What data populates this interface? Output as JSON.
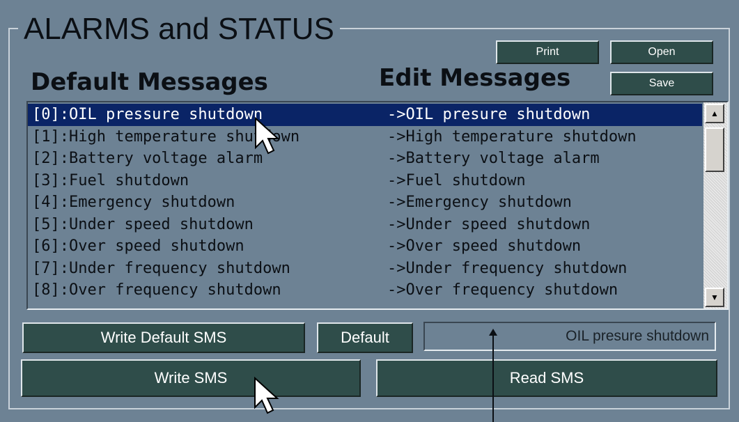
{
  "panel": {
    "title": "ALARMS and STATUS"
  },
  "headings": {
    "default_messages": "Default Messages",
    "edit_messages": "Edit Messages"
  },
  "toolbar": {
    "print_label": "Print",
    "open_label": "Open",
    "save_label": "Save"
  },
  "messages": [
    {
      "default": "[0]:OIL pressure shutdown",
      "edit": "->OIL presure shutdown",
      "selected": true
    },
    {
      "default": "[1]:High temperature shutdown",
      "edit": "->High temperature shutdown",
      "selected": false
    },
    {
      "default": "[2]:Battery voltage alarm",
      "edit": "->Battery voltage alarm",
      "selected": false
    },
    {
      "default": "[3]:Fuel shutdown",
      "edit": "->Fuel shutdown",
      "selected": false
    },
    {
      "default": "[4]:Emergency  shutdown",
      "edit": "->Emergency shutdown",
      "selected": false
    },
    {
      "default": "[5]:Under speed shutdown",
      "edit": "->Under speed shutdown",
      "selected": false
    },
    {
      "default": "[6]:Over speed shutdown",
      "edit": "->Over speed shutdown",
      "selected": false
    },
    {
      "default": "[7]:Under frequency shutdown",
      "edit": "->Under frequency shutdown",
      "selected": false
    },
    {
      "default": "[8]:Over frequency shutdown",
      "edit": "->Over frequency shutdown",
      "selected": false
    }
  ],
  "controls": {
    "write_default_sms_label": "Write Default SMS",
    "default_label": "Default",
    "edit_field_value": "OIL presure shutdown",
    "write_sms_label": "Write SMS",
    "read_sms_label": "Read SMS"
  },
  "icons": {
    "scroll_up": "scroll-up-arrow-icon",
    "scroll_down": "scroll-down-arrow-icon",
    "cursor": "mouse-pointer-icon",
    "annotation_arrow": "annotation-arrow-icon"
  },
  "colors": {
    "background": "#6d8294",
    "button": "#2f4d4a",
    "selection": "#0a2466"
  }
}
